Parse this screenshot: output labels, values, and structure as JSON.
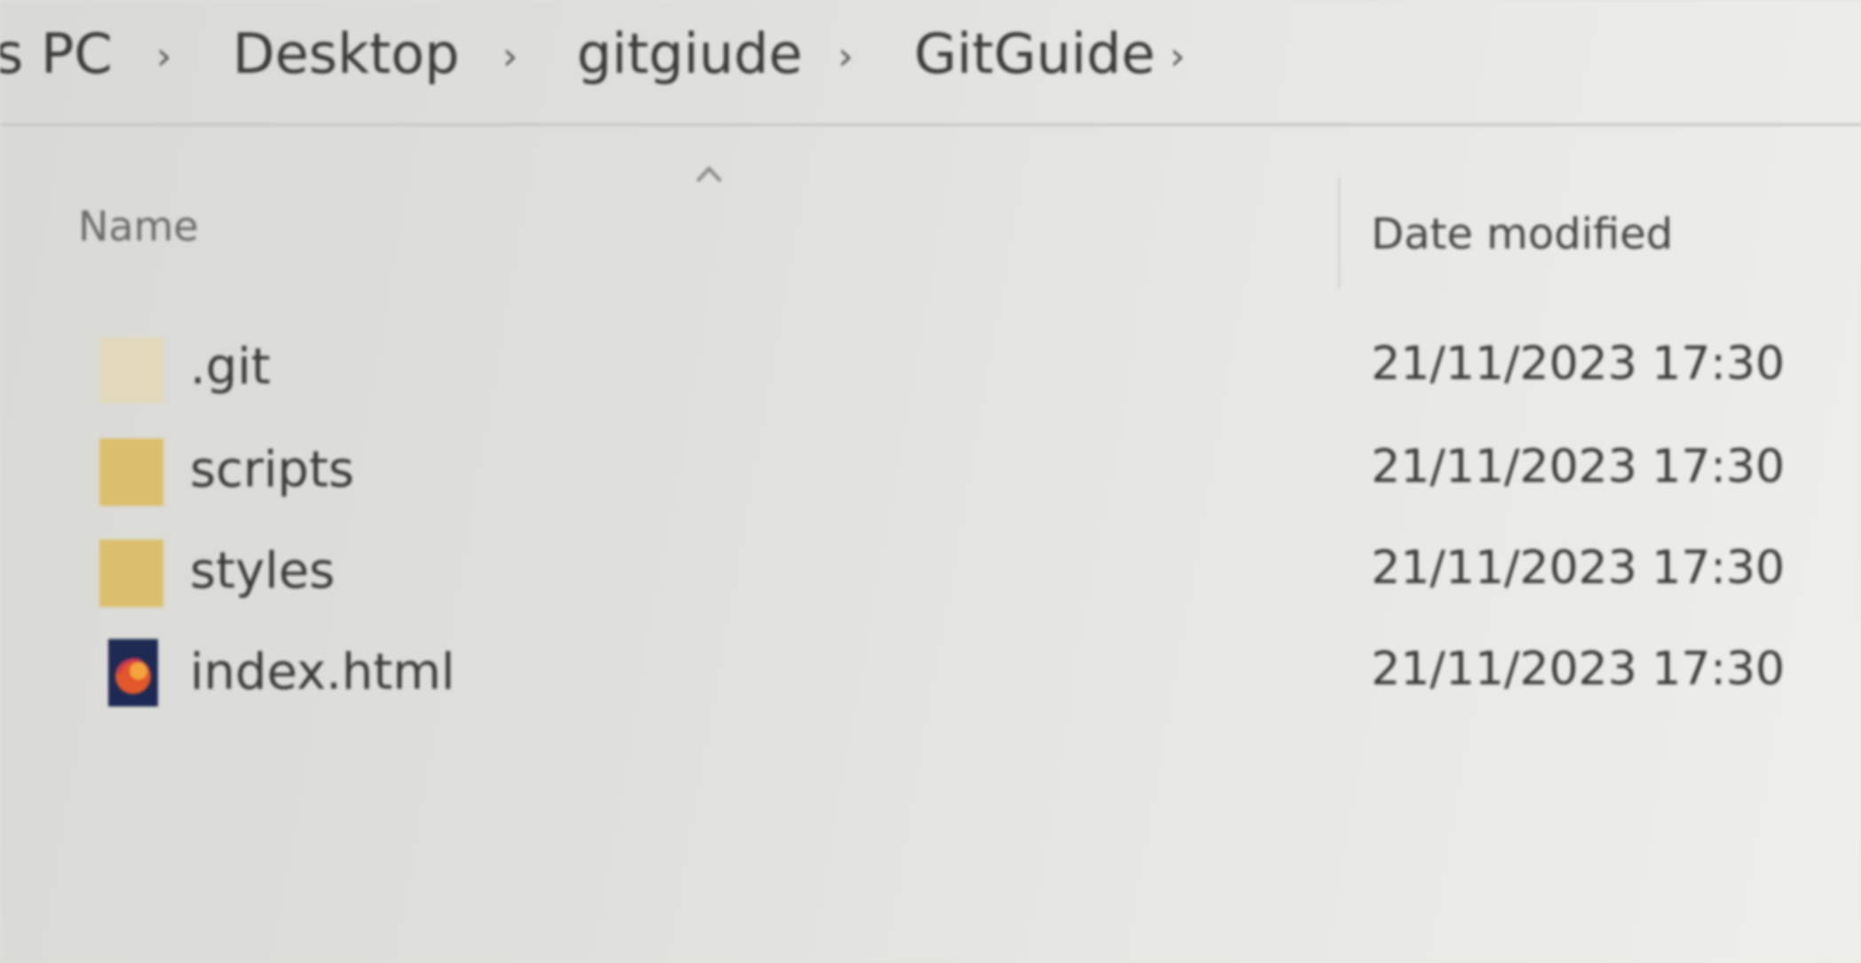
{
  "breadcrumb": {
    "items": [
      {
        "label": "s PC"
      },
      {
        "label": "Desktop"
      },
      {
        "label": "gitgiude"
      },
      {
        "label": "GitGuide"
      }
    ],
    "separator": "›"
  },
  "columns": {
    "name": "Name",
    "date_modified": "Date modified"
  },
  "files": [
    {
      "name": ".git",
      "type": "folder-hidden",
      "icon": "folder-icon",
      "date": "21/11/2023 17:30"
    },
    {
      "name": "scripts",
      "type": "folder",
      "icon": "folder-icon",
      "date": "21/11/2023 17:30"
    },
    {
      "name": "styles",
      "type": "folder",
      "icon": "folder-icon",
      "date": "21/11/2023 17:30"
    },
    {
      "name": "index.html",
      "type": "html",
      "icon": "firefox-html-file-icon",
      "date": "21/11/2023 17:30"
    }
  ],
  "colors": {
    "folder": "#dcbf6e",
    "folder_hidden": "#e2d9bd",
    "text": "#3a3a3a"
  }
}
